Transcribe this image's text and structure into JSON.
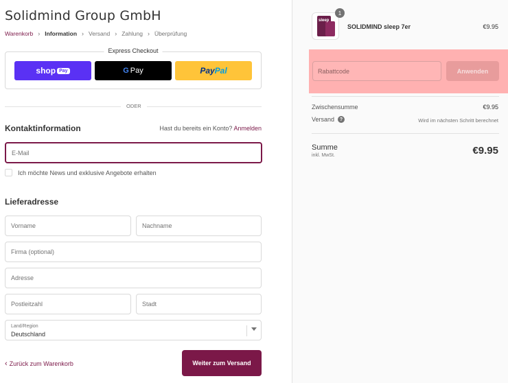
{
  "store": {
    "title": "Solidmind Group GmbH"
  },
  "breadcrumb": [
    {
      "label": "Warenkorb",
      "state": "link"
    },
    {
      "label": "Information",
      "state": "current"
    },
    {
      "label": "Versand",
      "state": "upcoming"
    },
    {
      "label": "Zahlung",
      "state": "upcoming"
    },
    {
      "label": "Überprüfung",
      "state": "upcoming"
    }
  ],
  "express": {
    "title": "Express Checkout",
    "shop_pay": {
      "label": "shop",
      "badge": "Pay"
    },
    "google_pay": {
      "g": "G",
      "label": "Pay"
    },
    "paypal": {
      "part1": "Pay",
      "part2": "Pal"
    },
    "divider": "ODER"
  },
  "contact": {
    "heading": "Kontaktinformation",
    "login_prompt": "Hast du bereits ein Konto?",
    "login_link": "Anmelden",
    "email_placeholder": "E-Mail",
    "newsletter_label": "Ich möchte News und exklusive Angebote erhalten"
  },
  "shipping": {
    "heading": "Lieferadresse",
    "first_name_placeholder": "Vorname",
    "last_name_placeholder": "Nachname",
    "company_placeholder": "Firma (optional)",
    "address_placeholder": "Adresse",
    "zip_placeholder": "Postleitzahl",
    "city_placeholder": "Stadt",
    "country_label": "Land/Region",
    "country_value": "Deutschland"
  },
  "footer": {
    "back_label": "Zurück zum Warenkorb",
    "continue_label": "Weiter zum Versand"
  },
  "summary": {
    "product": {
      "name": "SOLIDMIND sleep 7er",
      "price": "€9.95",
      "quantity": "1",
      "thumb_text": "sleep"
    },
    "discount_placeholder": "Rabattcode",
    "apply_label": "Anwenden",
    "subtotal_label": "Zwischensumme",
    "subtotal_value": "€9.95",
    "shipping_label": "Versand",
    "shipping_value": "Wird im nächsten Schritt berechnet",
    "total_label": "Summe",
    "total_sub": "inkl. MwSt.",
    "total_value": "€9.95"
  },
  "colors": {
    "brand": "#7b1848",
    "shop_pay": "#5a31f4",
    "paypal": "#ffc439",
    "discount_highlight": "#ffb1b1"
  }
}
